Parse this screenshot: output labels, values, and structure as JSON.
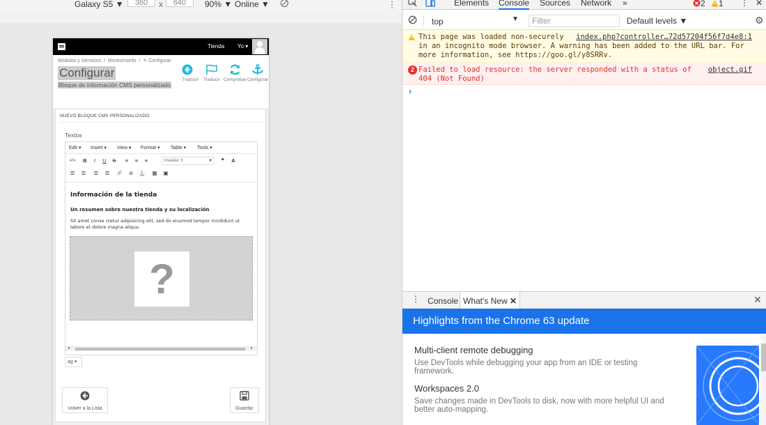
{
  "device_toolbar": {
    "device": "Galaxy S5 ▼",
    "width": "360",
    "times": "x",
    "height": "640",
    "zoom": "90% ▼",
    "network": "Online ▼"
  },
  "prestashop": {
    "top_nav": {
      "shop_label": "Tienda",
      "user_label": "Yo ▾"
    },
    "breadcrumb": {
      "item1": "Módulos y Servicios",
      "item2": "blockcmsinfo",
      "item3": "Configurar"
    },
    "title": "Configurar",
    "subtitle": "Bloque de información CMS personalizado",
    "toolbar_buttons": [
      {
        "label": "Traducir"
      },
      {
        "label": "Traducir"
      },
      {
        "label": "Comprobar"
      },
      {
        "label": "Configurar"
      }
    ],
    "panel_heading": "NUEVO BLOQUE CMS PERSONALIZADO",
    "field_label": "Textos",
    "editor": {
      "menus": [
        "Edit ▾",
        "Insert ▾",
        "View ▾",
        "Format ▾",
        "Table ▾",
        "Tools ▾"
      ],
      "row1": [
        "</>",
        "B",
        "I",
        "U",
        "S",
        "≡",
        "≡",
        "≡"
      ],
      "format_select": "Header 3",
      "row1b": [
        "❞",
        "A"
      ],
      "row2": [
        "☰",
        "☰",
        "☰",
        "☰",
        "🔗",
        "⊘",
        "⚓",
        "▦",
        "▣"
      ],
      "content": {
        "h1": "Información de la tienda",
        "h2": "Un resumen sobre nuestra tienda y su localización",
        "paragraph": "Sit amet conse ctetur adipisicing elit, sed do eiusmod tempor incididunt ut labore et dolore magna aliqua.",
        "image_placeholder": "?"
      }
    },
    "language_select": "ag ▾",
    "back_button": "Volver a la Lista",
    "save_button": "Guardar"
  },
  "devtools": {
    "tabs": [
      "Elements",
      "Console",
      "Sources",
      "Network",
      "»"
    ],
    "active_tab": "Console",
    "error_count": "2",
    "warning_count": "1",
    "context": "top",
    "filter_placeholder": "Filter",
    "levels": "Default levels ▼",
    "messages": [
      {
        "type": "warning",
        "text": "This page was loaded non-securely\nin an incognito mode browser. A warning has been added to the URL bar. For\nmore information, see https://goo.gl/y8SRRv.",
        "source": "index.php?controller…72d57204f56f7d4e8:1"
      },
      {
        "type": "error",
        "count": "2",
        "text": "Failed to load resource: the server responded with a status of\n404 (Not Found)",
        "source": "object.gif"
      }
    ],
    "drawer": {
      "tabs": [
        "Console",
        "What's New"
      ],
      "banner": "Highlights from the Chrome 63 update",
      "features": [
        {
          "title": "Multi-client remote debugging",
          "desc": "Use DevTools while debugging your app from an IDE or testing framework."
        },
        {
          "title": "Workspaces 2.0",
          "desc": "Save changes made in DevTools to disk, now with more helpful UI and better auto-mapping."
        }
      ]
    }
  },
  "colors": {
    "devtools_accent": "#1a73e8",
    "error": "#e0312a",
    "warning": "#f4b400",
    "prestashop_blue": "#25b9d7"
  }
}
